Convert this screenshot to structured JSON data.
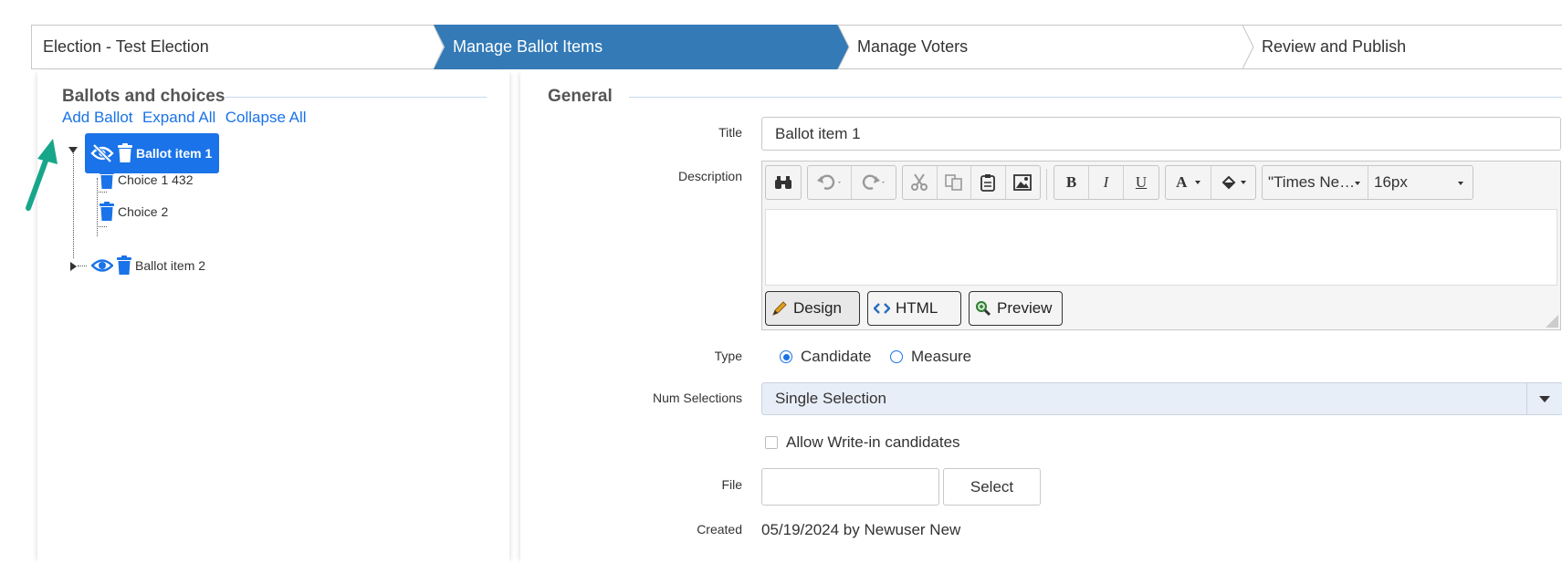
{
  "wizard": {
    "steps": [
      {
        "label": "Election - Test Election"
      },
      {
        "label": "Manage Ballot Items"
      },
      {
        "label": "Manage Voters"
      },
      {
        "label": "Review and Publish"
      }
    ],
    "active_color": "#337ab7"
  },
  "left": {
    "title": "Ballots and choices",
    "actions": {
      "add": "Add Ballot",
      "expand": "Expand All",
      "collapse": "Collapse All"
    },
    "tree": {
      "item1": {
        "label": "Ballot item 1",
        "icons": [
          "eye-slash-icon",
          "trash-icon"
        ]
      },
      "choice1": {
        "label": "Choice 1 432",
        "icon": "trash-icon"
      },
      "choice2": {
        "label": "Choice 2",
        "icon": "trash-icon"
      },
      "item2": {
        "label": "Ballot item 2",
        "icons": [
          "eye-icon",
          "trash-icon"
        ]
      }
    },
    "accent": "#1a73e8"
  },
  "general": {
    "title": "General",
    "labels": {
      "title": "Title",
      "description": "Description",
      "type": "Type",
      "num_selections": "Num Selections",
      "file": "File",
      "created": "Created"
    },
    "title_value": "Ballot item 1",
    "editor": {
      "font_name": "\"Times Ne…",
      "font_size": "16px",
      "modes": {
        "design": "Design",
        "html": "HTML",
        "preview": "Preview"
      },
      "active_mode": "Design"
    },
    "type_options": {
      "candidate": "Candidate",
      "measure": "Measure"
    },
    "type_selected": "Candidate",
    "num_selections_value": "Single Selection",
    "write_in_label": "Allow Write-in candidates",
    "write_in_checked": false,
    "file_button": "Select",
    "created_value": "05/19/2024 by Newuser New"
  }
}
